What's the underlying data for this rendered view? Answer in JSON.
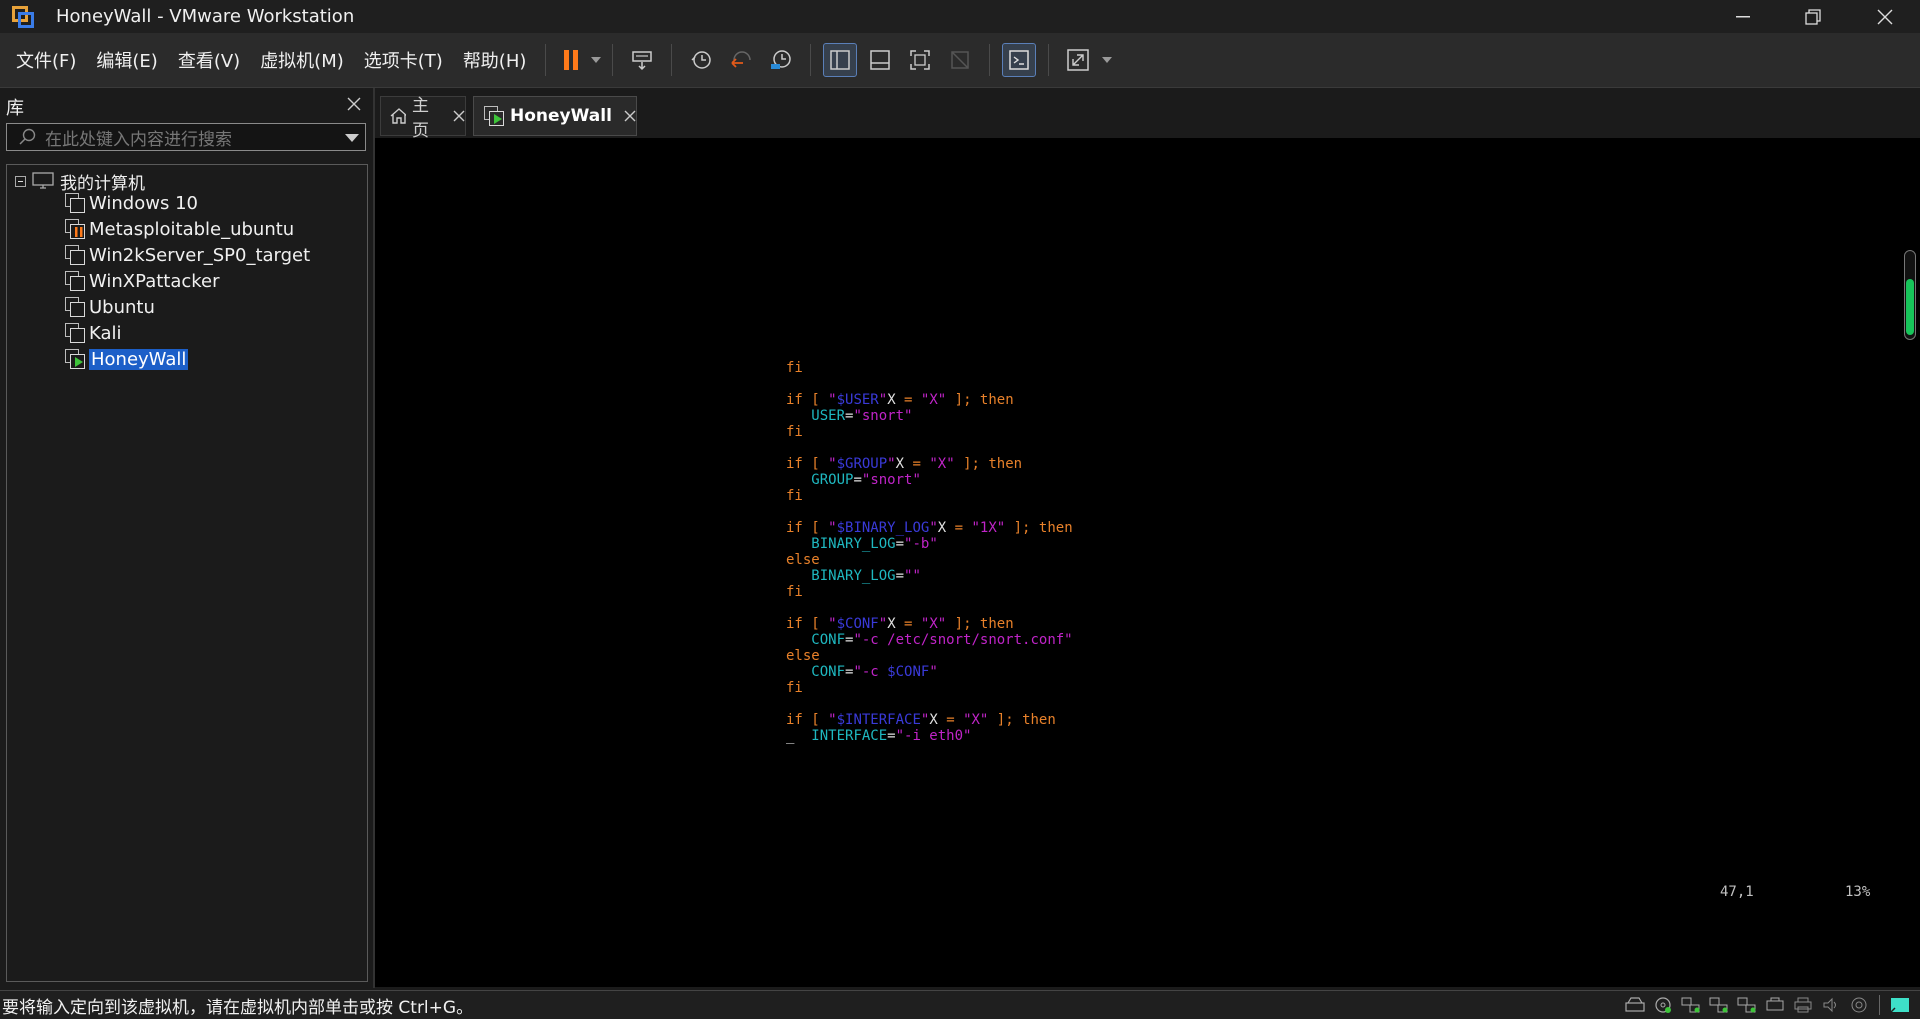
{
  "window": {
    "title": "HoneyWall - VMware Workstation"
  },
  "menu": [
    "文件(F)",
    "编辑(E)",
    "查看(V)",
    "虚拟机(M)",
    "选项卡(T)",
    "帮助(H)"
  ],
  "library": {
    "header": "库",
    "search_placeholder": "在此处键入内容进行搜索",
    "root": "我的计算机",
    "vms": [
      {
        "name": "Windows 10",
        "state": "off"
      },
      {
        "name": "Metasploitable_ubuntu",
        "state": "paused"
      },
      {
        "name": "Win2kServer_SP0_target",
        "state": "off"
      },
      {
        "name": "WinXPattacker",
        "state": "off"
      },
      {
        "name": "Ubuntu",
        "state": "off"
      },
      {
        "name": "Kali",
        "state": "off"
      },
      {
        "name": "HoneyWall",
        "state": "running",
        "selected": true
      }
    ]
  },
  "tabs": [
    {
      "label": "主页",
      "icon": "home-icon"
    },
    {
      "label": "HoneyWall",
      "icon": "vm-running-icon",
      "active": true
    }
  ],
  "terminal": {
    "status_position": "47,1",
    "status_percent": "13%"
  },
  "status": {
    "text": "要将输入定向到该虚拟机，请在虚拟机内部单击或按 Ctrl+G。"
  },
  "colors": {
    "pause": "#ff7a1a",
    "accent": "#1c5fc8",
    "scroll_thumb": "#17c45a",
    "keyword": "#e8812a",
    "variable": "#3a3ad8",
    "string": "#c024c8",
    "identifier": "#1fb8c0"
  }
}
